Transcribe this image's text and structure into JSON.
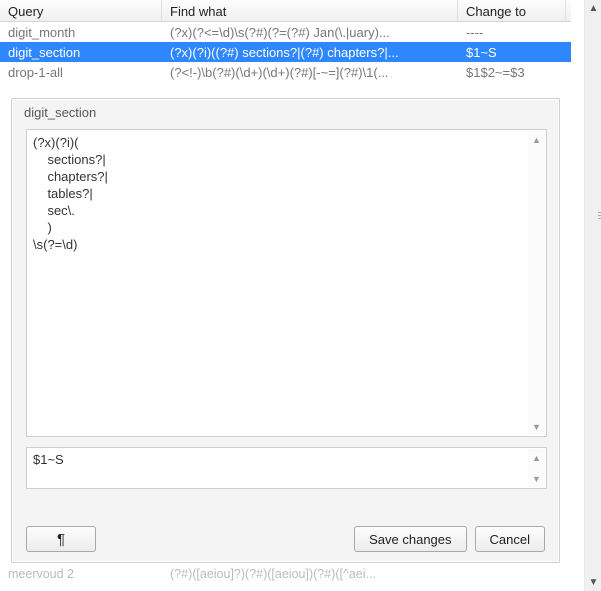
{
  "grid": {
    "headers": {
      "query": "Query",
      "find": "Find what",
      "change": "Change to"
    },
    "rows": [
      {
        "query": "digit_month",
        "find": "(?x)(?<=\\d)\\s(?#)(?=(?#)    Jan(\\.|uary)...",
        "change": "----",
        "selected": false
      },
      {
        "query": "digit_section",
        "find": "(?x)(?i)((?#)    sections?|(?#)    chapters?|...",
        "change": "$1~S",
        "selected": true
      },
      {
        "query": "drop-1-all",
        "find": "(?<!-)\\b(?#)(\\d+)(\\d+)(?#)[-~=](?#)\\1(...",
        "change": "$1$2~=$3",
        "selected": false
      }
    ]
  },
  "dialog": {
    "title": "digit_section",
    "find_text": "(?x)(?i)(\n    sections?|\n    chapters?|\n    tables?|\n    sec\\.\n    )\n\\s(?=\\d)",
    "replace_text": "$1~S",
    "buttons": {
      "pilcrow": "¶",
      "save": "Save changes",
      "cancel": "Cancel"
    }
  },
  "bottom_hint": {
    "left": "meervoud 2",
    "right": "(?#)([aeiou]?)(?#)([aeiou])(?#)([^aei..."
  }
}
